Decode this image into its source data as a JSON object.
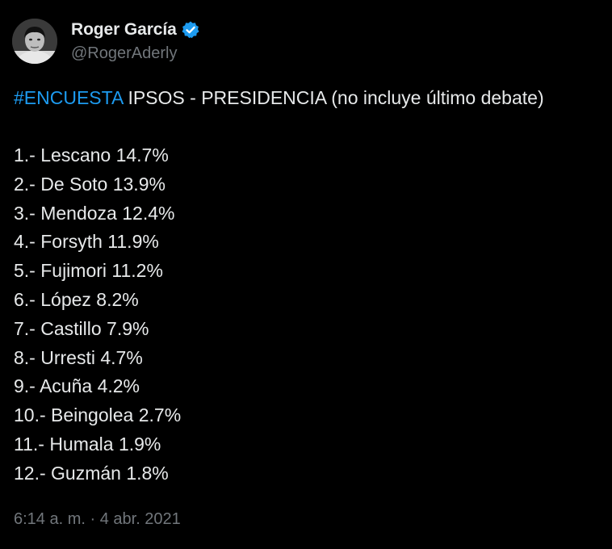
{
  "colors": {
    "background": "#000000",
    "text": "#e7e9ea",
    "secondary": "#71767b",
    "accent": "#1d9bf0"
  },
  "tweet": {
    "author": {
      "display_name": "Roger García",
      "handle": "@RogerAderly",
      "verified_icon": "verified-badge-icon",
      "avatar": "avatar"
    },
    "text": {
      "hashtag": "#ENCUESTA",
      "headline": " IPSOS - PRESIDENCIA (no incluye último debate)"
    },
    "results": [
      "1.- Lescano 14.7%",
      "2.- De Soto 13.9%",
      "3.- Mendoza 12.4%",
      "4.- Forsyth 11.9%",
      "5.- Fujimori 11.2%",
      "6.- López 8.2%",
      "7.- Castillo 7.9%",
      "8.- Urresti 4.7%",
      "9.- Acuña 4.2%",
      "10.- Beingolea 2.7%",
      "11.- Humala 1.9%",
      "12.- Guzmán 1.8%"
    ],
    "timestamp": "6:14 a. m. · 4 abr. 2021"
  }
}
